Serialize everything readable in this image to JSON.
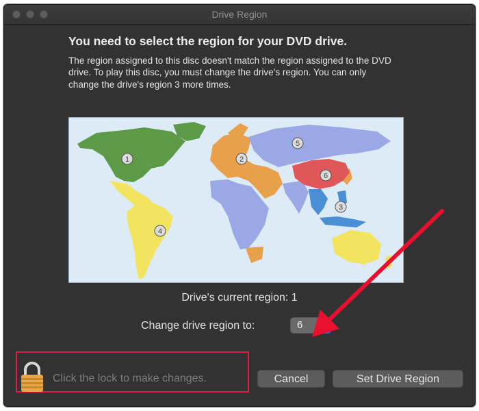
{
  "window": {
    "title": "Drive Region"
  },
  "dialog": {
    "heading": "You need to select the region for your DVD drive.",
    "message": "The region assigned to this disc doesn't match the region assigned to the DVD drive. To play this disc, you must change the drive's region. You can only change the drive's region 3 more times.",
    "current_region_text": "Drive's current region: 1",
    "change_label": "Change drive region to:",
    "selected_region": "6"
  },
  "map": {
    "region_labels": [
      "1",
      "2",
      "3",
      "4",
      "5",
      "6"
    ],
    "colors": {
      "ocean": "#dcebf5",
      "region1": "#5c9a48",
      "region2": "#e8a04a",
      "region3": "#4a8fd6",
      "region4": "#f2e45e",
      "region5": "#9aa9e6",
      "region6": "#e0575a"
    }
  },
  "footer": {
    "lock_text": "Click the lock to make changes.",
    "cancel_label": "Cancel",
    "set_label": "Set Drive Region"
  },
  "icons": {
    "lock": "lock-icon",
    "select_chevron": "chevron-up-down-icon",
    "annotation_arrow": "red-arrow-icon"
  },
  "annotation_colors": {
    "highlight": "#e21d48",
    "arrow": "#e8102e"
  }
}
